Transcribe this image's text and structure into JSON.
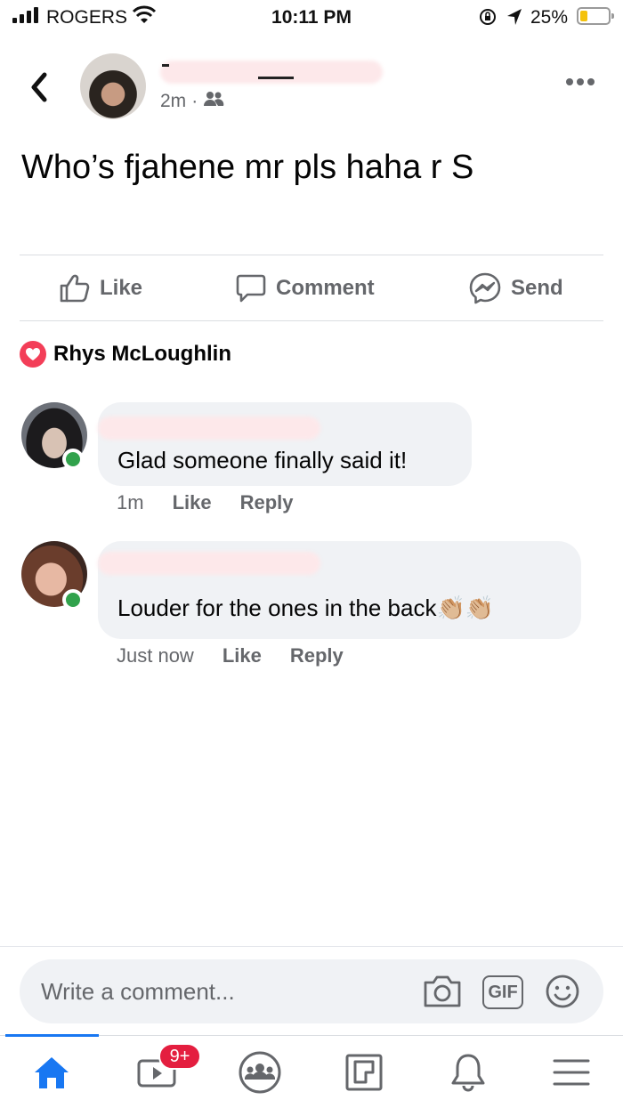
{
  "status_bar": {
    "carrier": "ROGERS",
    "time": "10:11 PM",
    "battery_percent": "25%",
    "battery_level": 0.25,
    "icons": [
      "signal-icon",
      "wifi-icon",
      "orientation-lock-icon",
      "location-icon",
      "battery-icon"
    ]
  },
  "post": {
    "time": "2m",
    "separator": "·",
    "audience_icon": "friends-icon",
    "text": "Who’s fjahene mr pls haha r S"
  },
  "actions": {
    "like": "Like",
    "comment": "Comment",
    "send": "Send"
  },
  "reactions": {
    "name": "Rhys McLoughlin"
  },
  "comments": [
    {
      "text": "Glad someone finally said it!",
      "time": "1m",
      "like": "Like",
      "reply": "Reply"
    },
    {
      "text": "Louder for the ones in the back",
      "emoji": "👏🏼👏🏼",
      "time": "Just now",
      "like": "Like",
      "reply": "Reply"
    }
  ],
  "composer": {
    "placeholder": "Write a comment...",
    "gif_label": "GIF"
  },
  "tab_bar": {
    "video_badge": "9+",
    "tabs": [
      "home-icon",
      "video-icon",
      "groups-icon",
      "pages-icon",
      "notifications-icon",
      "menu-icon"
    ]
  },
  "colors": {
    "accent": "#1877f2",
    "secondary_text": "#65676b",
    "bubble": "#f0f2f5",
    "online": "#31a24c",
    "love": "#f33e58",
    "badge": "#e41e3f"
  }
}
